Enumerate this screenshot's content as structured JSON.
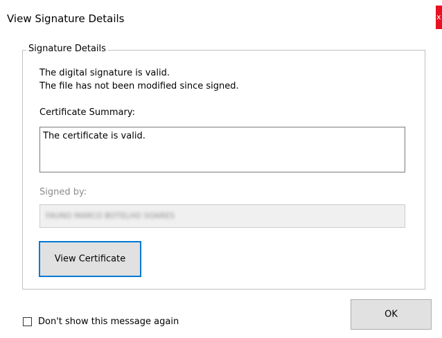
{
  "window": {
    "title": "View Signature Details",
    "close_glyph": "x",
    "close_color": "#e81123"
  },
  "group": {
    "legend": "Signature Details",
    "status_lines": [
      "The digital signature is valid.",
      "The file has not been modified since signed."
    ],
    "summary_label": "Certificate Summary:",
    "summary_value": "The certificate is valid.",
    "signed_by_label": "Signed by:",
    "signed_by_value": "FAUNO MARCO BOTELHO SOARES",
    "view_certificate_label": "View Certificate"
  },
  "footer": {
    "checkbox_label": "Don't show this message again",
    "checkbox_checked": false,
    "ok_label": "OK"
  },
  "colors": {
    "accent": "#0078d7",
    "button_face": "#e1e1e1"
  }
}
